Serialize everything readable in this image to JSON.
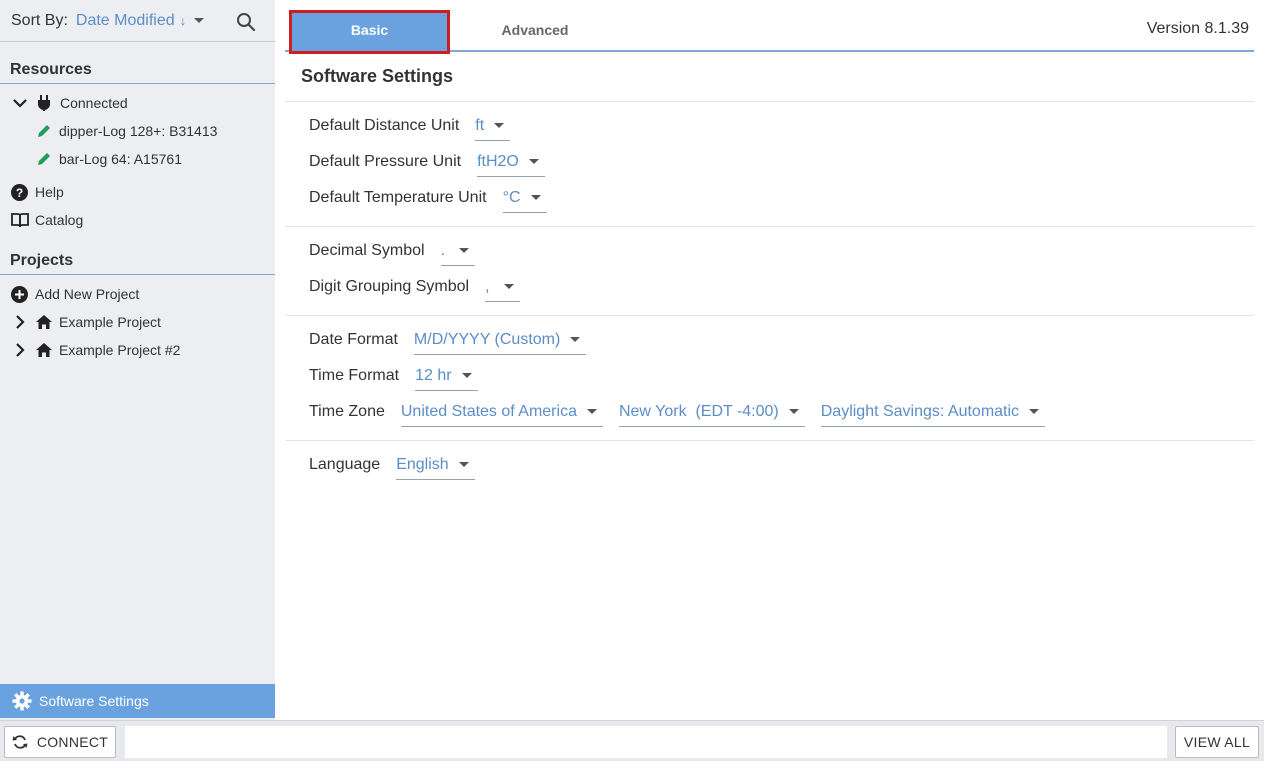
{
  "sidebar": {
    "sort_label": "Sort By:",
    "sort_value": "Date Modified",
    "sort_direction": "↓",
    "resources_title": "Resources",
    "connected_label": "Connected",
    "devices": [
      {
        "label": "dipper-Log 128+: B31413"
      },
      {
        "label": "bar-Log 64: A15761"
      }
    ],
    "help_label": "Help",
    "catalog_label": "Catalog",
    "projects_title": "Projects",
    "add_project_label": "Add New Project",
    "projects": [
      {
        "label": "Example Project"
      },
      {
        "label": "Example Project #2"
      }
    ],
    "active_item_label": "Software Settings"
  },
  "tabs": {
    "basic": "Basic",
    "advanced": "Advanced"
  },
  "version": "Version 8.1.39",
  "page_title": "Software Settings",
  "settings": {
    "distance": {
      "label": "Default Distance Unit",
      "value": "ft"
    },
    "pressure": {
      "label": "Default Pressure Unit",
      "value": "ftH2O"
    },
    "temperature": {
      "label": "Default Temperature Unit",
      "value": "°C"
    },
    "decimal": {
      "label": "Decimal Symbol",
      "value": "."
    },
    "grouping": {
      "label": "Digit Grouping Symbol",
      "value": ","
    },
    "date_format": {
      "label": "Date Format",
      "value": "M/D/YYYY (Custom)"
    },
    "time_format": {
      "label": "Time Format",
      "value": "12 hr"
    },
    "time_zone": {
      "label": "Time Zone",
      "country": "United States of America",
      "city": "New York  (EDT -4:00)",
      "dst": "Daylight Savings: Automatic"
    },
    "language": {
      "label": "Language",
      "value": "English"
    }
  },
  "bottom": {
    "connect_label": "CONNECT",
    "view_all_label": "VIEW ALL"
  },
  "colors": {
    "accent": "#6aa1df",
    "link": "#5b8dc7",
    "highlight_border": "#cc1f1f",
    "device_icon": "#1e9e5a"
  }
}
